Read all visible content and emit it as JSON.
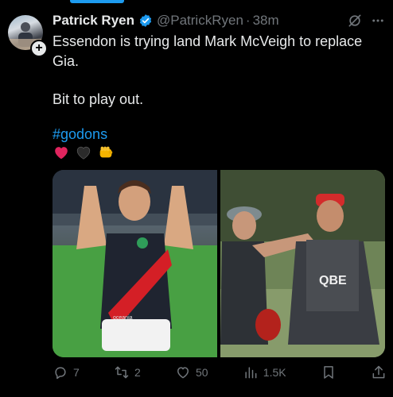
{
  "author": {
    "name": "Patrick Ryen",
    "handle": "@PatrickRyen",
    "separator": "·",
    "time": "38m"
  },
  "tweet": {
    "paragraph1": "Essendon is trying land Mark McVeigh to replace Gia.",
    "paragraph2": "Bit to play out.",
    "hashtag": "#godons",
    "emoji_icons": [
      "red-heart-icon",
      "black-heart-icon",
      "fist-icon"
    ]
  },
  "media": {
    "photos": [
      "football-player-photo",
      "coaches-photo"
    ],
    "left_photo_text": "oceania",
    "right_photo_text": "QBE"
  },
  "metrics": {
    "replies": "7",
    "reposts": "2",
    "likes": "50",
    "views": "1.5K"
  },
  "colors": {
    "accent": "#1d9bf0",
    "text": "#e7e9ea",
    "secondary": "#71767b",
    "background": "#000000"
  }
}
